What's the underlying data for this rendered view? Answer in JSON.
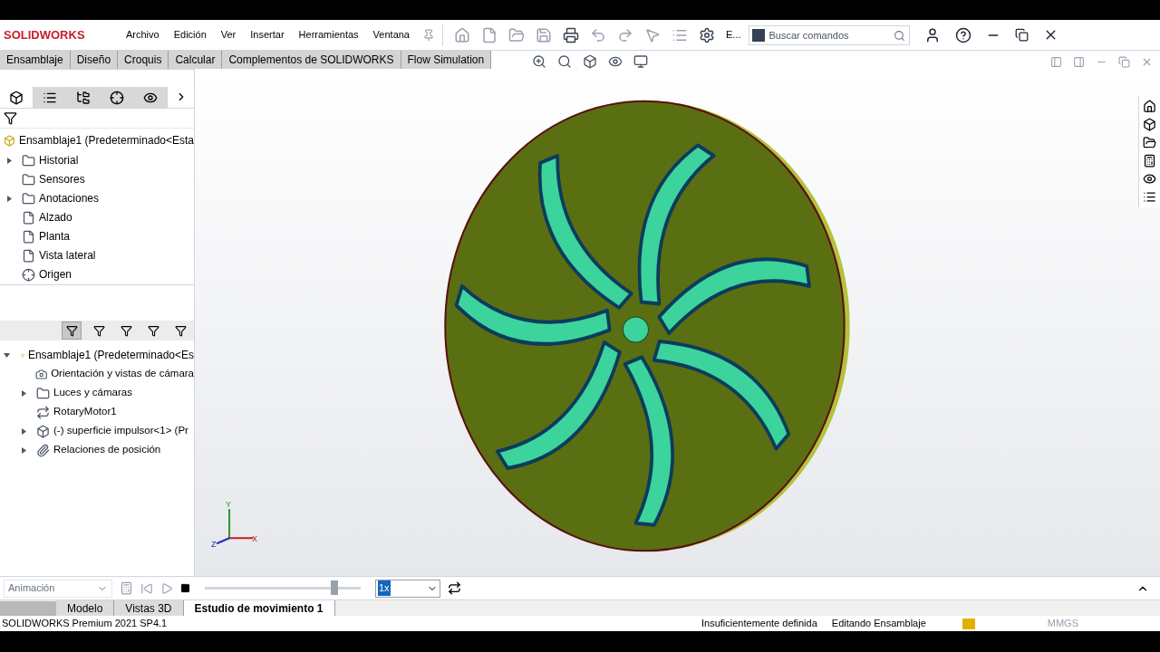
{
  "app": {
    "logo": "SOLIDWORKS"
  },
  "menu": [
    "Archivo",
    "Edición",
    "Ver",
    "Insertar",
    "Herramientas",
    "Ventana"
  ],
  "toolbar_cut_label": "E...",
  "search": {
    "placeholder": "Buscar comandos"
  },
  "command_tabs": [
    {
      "label": "Ensamblaje",
      "selected": false
    },
    {
      "label": "Diseño",
      "selected": false
    },
    {
      "label": "Croquis",
      "selected": false
    },
    {
      "label": "Calcular",
      "selected": false
    },
    {
      "label": "Complementos de SOLIDWORKS",
      "selected": false
    },
    {
      "label": "Flow Simulation",
      "selected": false
    }
  ],
  "manager_tabs": [
    {
      "selected": true
    },
    {
      "selected": false
    },
    {
      "selected": false
    },
    {
      "selected": false
    },
    {
      "selected": false
    }
  ],
  "feature_tree": {
    "root": "Ensamblaje1  (Predeterminado<Esta",
    "items": [
      {
        "label": "Historial",
        "kind": "collapsed"
      },
      {
        "label": "Sensores",
        "kind": "leaf"
      },
      {
        "label": "Anotaciones",
        "kind": "collapsed"
      },
      {
        "label": "Alzado",
        "kind": "leaf"
      },
      {
        "label": "Planta",
        "kind": "leaf"
      },
      {
        "label": "Vista lateral",
        "kind": "leaf"
      },
      {
        "label": "Origen",
        "kind": "leaf"
      }
    ]
  },
  "motion_filters": [
    {
      "selected": true
    },
    {
      "selected": false
    },
    {
      "selected": false
    },
    {
      "selected": false
    },
    {
      "selected": false
    }
  ],
  "motion_tree": {
    "root": {
      "label": "Ensamblaje1  (Predeterminado<Es",
      "kind": "expanded"
    },
    "items": [
      {
        "label": "Orientación y vistas de cámara",
        "kind": "leaf"
      },
      {
        "label": "Luces y cámaras",
        "kind": "collapsed"
      },
      {
        "label": "RotaryMotor1",
        "kind": "leaf"
      },
      {
        "label": "(-) superficie impulsor<1> (Pr",
        "kind": "collapsed"
      },
      {
        "label": "Relaciones de posición",
        "kind": "collapsed"
      }
    ]
  },
  "motion_bar": {
    "study_type": "Animación",
    "timeline": {
      "level": 0.83
    },
    "speed": "1x"
  },
  "bottom_tabs": [
    {
      "label": "Modelo",
      "selected": false
    },
    {
      "label": "Vistas 3D",
      "selected": false
    },
    {
      "label": "Estudio de movimiento 1",
      "selected": true
    }
  ],
  "status_bar": {
    "product": "SOLIDWORKS Premium 2021 SP4.1",
    "definition": "Insuficientemente definida",
    "mode": "Editando Ensamblaje",
    "units": "MMGS"
  },
  "triad": {
    "x": "X",
    "y": "Y",
    "z": "Z"
  }
}
